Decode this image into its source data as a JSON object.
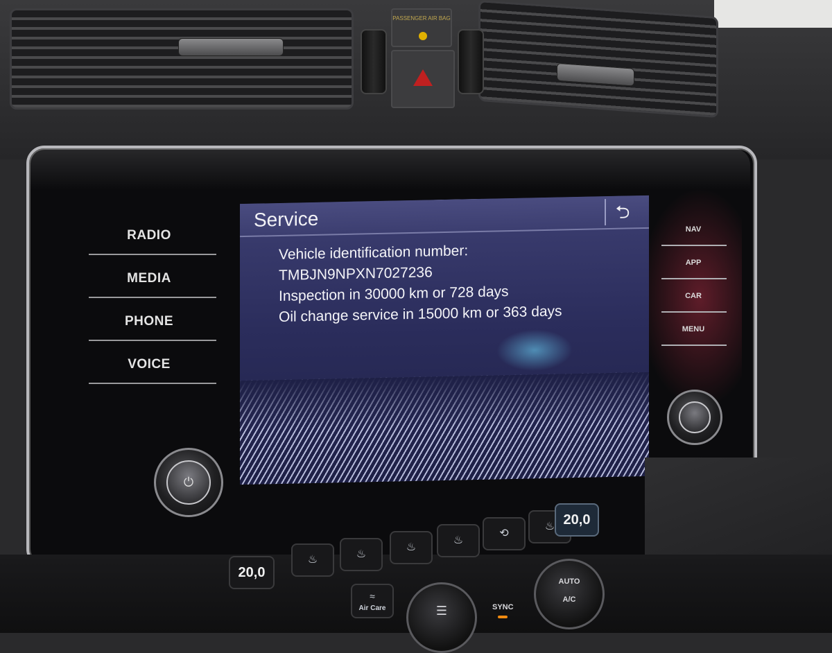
{
  "dashboard": {
    "airbag_label": "PASSENGER AIR BAG"
  },
  "infotainment": {
    "left_buttons": [
      "RADIO",
      "MEDIA",
      "PHONE",
      "VOICE"
    ],
    "right_buttons": [
      "NAV",
      "APP",
      "CAR",
      "MENU"
    ],
    "screen": {
      "title": "Service",
      "back_icon": "⮌",
      "lines": [
        "Vehicle identification number:",
        "TMBJN9NPXN7027236",
        "Inspection in 30000 km or 728 days",
        "Oil change service in 15000 km or 363 days"
      ]
    },
    "power_icon": "⏻"
  },
  "climate": {
    "left_temp": "20,0",
    "right_temp": "20,0",
    "aircare_label": "Air Care",
    "sync_label": "SYNC",
    "auto_label": "AUTO",
    "ac_label": "A/C",
    "accent_color": "#f08a10"
  }
}
